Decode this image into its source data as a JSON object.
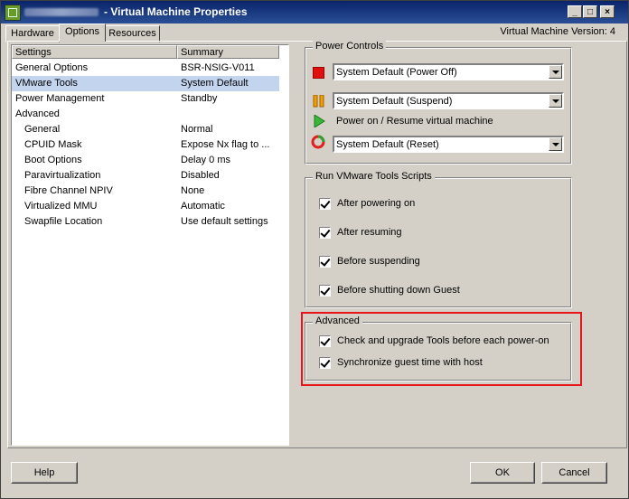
{
  "window": {
    "title": "- Virtual Machine Properties",
    "vm_version": "Virtual Machine Version: 4",
    "controls": {
      "minimize": "_",
      "maximize": "□",
      "close": "×"
    }
  },
  "tabs": [
    {
      "label": "Hardware"
    },
    {
      "label": "Options"
    },
    {
      "label": "Resources"
    }
  ],
  "settings_list": {
    "header_settings": "Settings",
    "header_summary": "Summary",
    "rows": [
      {
        "name": "General Options",
        "summary": "BSR-NSIG-V011"
      },
      {
        "name": "VMware Tools",
        "summary": "System Default"
      },
      {
        "name": "Power Management",
        "summary": "Standby"
      },
      {
        "name": "Advanced",
        "summary": ""
      },
      {
        "name": "General",
        "summary": "Normal"
      },
      {
        "name": "CPUID Mask",
        "summary": "Expose Nx flag to ..."
      },
      {
        "name": "Boot Options",
        "summary": "Delay 0 ms"
      },
      {
        "name": "Paravirtualization",
        "summary": "Disabled"
      },
      {
        "name": "Fibre Channel NPIV",
        "summary": "None"
      },
      {
        "name": "Virtualized MMU",
        "summary": "Automatic"
      },
      {
        "name": "Swapfile Location",
        "summary": "Use default settings"
      }
    ]
  },
  "power_controls": {
    "title": "Power Controls",
    "power_off": "System Default (Power Off)",
    "suspend": "System Default (Suspend)",
    "power_on_label": "Power on / Resume virtual machine",
    "reset": "System Default (Reset)"
  },
  "tools_scripts": {
    "title": "Run VMware Tools Scripts",
    "items": [
      {
        "label": "After powering on",
        "checked": true
      },
      {
        "label": "After resuming",
        "checked": true
      },
      {
        "label": "Before suspending",
        "checked": true
      },
      {
        "label": "Before shutting down Guest",
        "checked": true
      }
    ]
  },
  "advanced": {
    "title": "Advanced",
    "items": [
      {
        "label": "Check and upgrade Tools before each power-on",
        "checked": true
      },
      {
        "label": "Synchronize guest time with host",
        "checked": true
      }
    ]
  },
  "buttons": {
    "help": "Help",
    "ok": "OK",
    "cancel": "Cancel"
  },
  "colors": {
    "highlight_border": "#e8141c",
    "selected_row": "#c3d4ef",
    "titlebar": "#0a246a"
  }
}
